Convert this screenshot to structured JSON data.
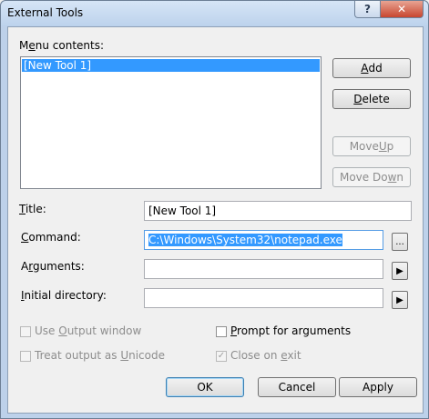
{
  "window": {
    "title": "External Tools",
    "help_label": "?",
    "close_label": "✕"
  },
  "menu_contents": {
    "label_pre": "M",
    "label_ul": "e",
    "label_post": "nu contents:",
    "items": [
      "[New Tool 1]"
    ]
  },
  "buttons": {
    "add": {
      "pre": "",
      "ul": "A",
      "post": "dd"
    },
    "delete": {
      "pre": "",
      "ul": "D",
      "post": "elete"
    },
    "move_up": {
      "pre": "Move ",
      "ul": "U",
      "post": "p"
    },
    "move_down": {
      "pre": "Move Do",
      "ul": "w",
      "post": "n"
    },
    "ok": "OK",
    "cancel": "Cancel",
    "apply": "Apply"
  },
  "fields": {
    "title": {
      "label_pre": "",
      "label_ul": "T",
      "label_post": "itle:",
      "value": "[New Tool 1]"
    },
    "command": {
      "label_pre": "",
      "label_ul": "C",
      "label_post": "ommand:",
      "value": "C:\\Windows\\System32\\notepad.exe",
      "browse_label": "..."
    },
    "arguments": {
      "label_pre": "A",
      "label_ul": "r",
      "label_post": "guments:",
      "value": "",
      "arrow_label": "▶"
    },
    "initial_directory": {
      "label_pre": "",
      "label_ul": "I",
      "label_post": "nitial directory:",
      "value": "",
      "arrow_label": "▶"
    }
  },
  "checkboxes": {
    "use_output_window": {
      "pre": "Use ",
      "ul": "O",
      "post": "utput window",
      "checked": false,
      "enabled": false
    },
    "treat_unicode": {
      "pre": "Treat output as ",
      "ul": "U",
      "post": "nicode",
      "checked": false,
      "enabled": false
    },
    "prompt_args": {
      "pre": "",
      "ul": "P",
      "post": "rompt for arguments",
      "checked": false,
      "enabled": true
    },
    "close_on_exit": {
      "pre": "Close on ",
      "ul": "e",
      "post": "xit",
      "checked": true,
      "enabled": false
    }
  }
}
